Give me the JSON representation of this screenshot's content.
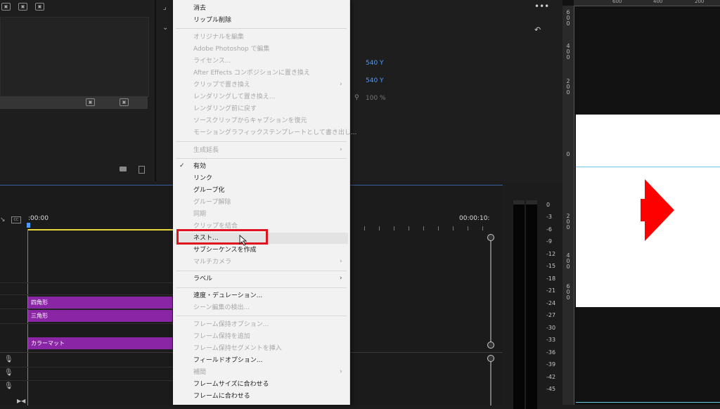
{
  "timeline": {
    "timecode_start": ":00:00",
    "timecode_end": "00:00:10:",
    "clips": [
      "四角形",
      "三角形",
      "カラーマット"
    ]
  },
  "effect_controls": {
    "pos_y1": "540 Y",
    "pos_y2": "540 Y",
    "scale": "100 %"
  },
  "meter": {
    "labels": [
      "0",
      "-3",
      "-6",
      "-9",
      "-12",
      "-15",
      "-18",
      "-21",
      "-24",
      "-27",
      "-30",
      "-33",
      "-36",
      "-39",
      "-42",
      "-45"
    ]
  },
  "ruler": {
    "top": [
      "600",
      "400",
      "200"
    ],
    "side_a": [
      "6",
      "0"
    ],
    "side_b": [
      "4",
      "0"
    ],
    "side_c": [
      "2",
      "0"
    ]
  },
  "menu": {
    "items": [
      {
        "label": "消去",
        "enabled": true
      },
      {
        "label": "リップル削除",
        "enabled": true
      },
      {
        "label": "オリジナルを編集",
        "enabled": false
      },
      {
        "label": "Adobe Photoshop で編集",
        "enabled": false
      },
      {
        "label": "ライセンス...",
        "enabled": false
      },
      {
        "label": "After Effects コンポジションに置き換え",
        "enabled": false
      },
      {
        "label": "クリップで置き換え",
        "enabled": false,
        "submenu": true
      },
      {
        "label": "レンダリングして置き換え...",
        "enabled": false
      },
      {
        "label": "レンダリング前に戻す",
        "enabled": false
      },
      {
        "label": "ソースクリップからキャプションを復元",
        "enabled": false
      },
      {
        "label": "モーショングラフィックステンプレートとして書き出し...",
        "enabled": false
      },
      {
        "label": "生成延長",
        "enabled": false,
        "submenu": true
      },
      {
        "label": "有効",
        "enabled": true,
        "checked": true
      },
      {
        "label": "リンク",
        "enabled": true
      },
      {
        "label": "グループ化",
        "enabled": true
      },
      {
        "label": "グループ解除",
        "enabled": false
      },
      {
        "label": "同期",
        "enabled": false
      },
      {
        "label": "クリップを結合",
        "enabled": false
      },
      {
        "label": "ネスト...",
        "enabled": true,
        "highlighted": true
      },
      {
        "label": "サブシーケンスを作成",
        "enabled": true
      },
      {
        "label": "マルチカメラ",
        "enabled": false,
        "submenu": true
      },
      {
        "label": "ラベル",
        "enabled": true,
        "submenu": true
      },
      {
        "label": "速度・デュレーション...",
        "enabled": true
      },
      {
        "label": "シーン編集の検出...",
        "enabled": false
      },
      {
        "label": "フレーム保持オプション...",
        "enabled": false
      },
      {
        "label": "フレーム保持を追加",
        "enabled": false
      },
      {
        "label": "フレーム保持セグメントを挿入",
        "enabled": false
      },
      {
        "label": "フィールドオプション...",
        "enabled": true
      },
      {
        "label": "補間",
        "enabled": false,
        "submenu": true
      },
      {
        "label": "フレームサイズに合わせる",
        "enabled": true
      },
      {
        "label": "フレームに合わせる",
        "enabled": true
      }
    ]
  },
  "colors": {
    "clip": "#8a26a6",
    "highlight_box": "#e0141e",
    "arrow_shape": "#ff0000",
    "accent_blue": "#4d9bff"
  }
}
